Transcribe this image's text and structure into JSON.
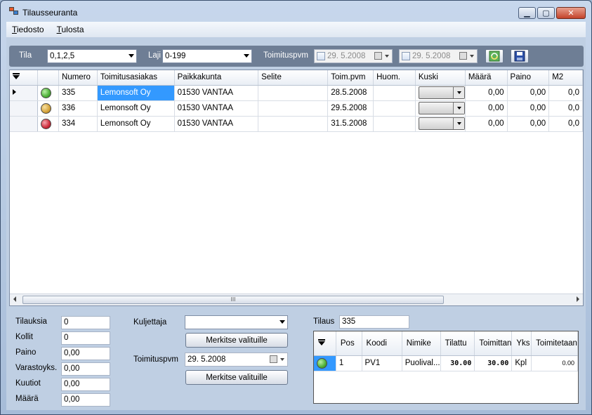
{
  "window": {
    "title": "Tilausseuranta",
    "minimize_glyph": "▁",
    "maximize_glyph": "▢",
    "close_glyph": "✕"
  },
  "menu": {
    "file_accel": "T",
    "file_rest": "iedosto",
    "print_accel": "T",
    "print_rest": "ulosta"
  },
  "filter": {
    "tila_label": "Tila",
    "tila_value": "0,1,2,5",
    "laji_label": "Laji",
    "laji_value": "0-199",
    "delivery_label": "Toimituspvm",
    "date_from": "29.  5.2008",
    "date_to": "29.  5.2008"
  },
  "orders_grid": {
    "columns": [
      "Numero",
      "Toimitusasiakas",
      "Paikkakunta",
      "Selite",
      "Toim.pvm",
      "Huom.",
      "Kuski",
      "Määrä",
      "Paino",
      "M2"
    ],
    "rows": [
      {
        "status_color": "#4caf36",
        "numero": "335",
        "asiakas": "Lemonsoft Oy",
        "paikkakunta": "01530  VANTAA",
        "selite": "",
        "toim_pvm": "28.5.2008",
        "huom": "",
        "maara": "0,00",
        "paino": "0,00",
        "m2": "0,0"
      },
      {
        "status_color": "#d4a23a",
        "numero": "336",
        "asiakas": "Lemonsoft Oy",
        "paikkakunta": "01530  VANTAA",
        "selite": "",
        "toim_pvm": "29.5.2008",
        "huom": "",
        "maara": "0,00",
        "paino": "0,00",
        "m2": "0,0"
      },
      {
        "status_color": "#cc2b3a",
        "numero": "334",
        "asiakas": "Lemonsoft Oy",
        "paikkakunta": "01530  VANTAA",
        "selite": "",
        "toim_pvm": "31.5.2008",
        "huom": "",
        "maara": "0,00",
        "paino": "0,00",
        "m2": "0,0"
      }
    ],
    "scroll_grip": "III"
  },
  "summary": {
    "items": [
      {
        "label": "Tilauksia",
        "value": "0"
      },
      {
        "label": "Kollit",
        "value": "0"
      },
      {
        "label": "Paino",
        "value": "0,00"
      },
      {
        "label": "Varastoyks.",
        "value": "0,00"
      },
      {
        "label": "Kuutiot",
        "value": "0,00"
      },
      {
        "label": "Määrä",
        "value": "0,00"
      }
    ]
  },
  "driver": {
    "label": "Kuljettaja",
    "value": "",
    "mark_button": "Merkitse valituille"
  },
  "delivery": {
    "label": "Toimituspvm",
    "value": "29.  5.2008",
    "mark_button": "Merkitse valituille"
  },
  "order": {
    "label": "Tilaus",
    "value": "335"
  },
  "lines_grid": {
    "columns": [
      "Pos",
      "Koodi",
      "Nimike",
      "Tilattu",
      "Toimittan",
      "Yks",
      "Toimitetaan"
    ],
    "rows": [
      {
        "status_color": "#4caf36",
        "pos": "1",
        "koodi": "PV1",
        "nimike": "Puolival...",
        "tilattu": "30.00",
        "toimitettu": "30.00",
        "yks": "Kpl",
        "toimitetaan": "0.00"
      }
    ]
  }
}
